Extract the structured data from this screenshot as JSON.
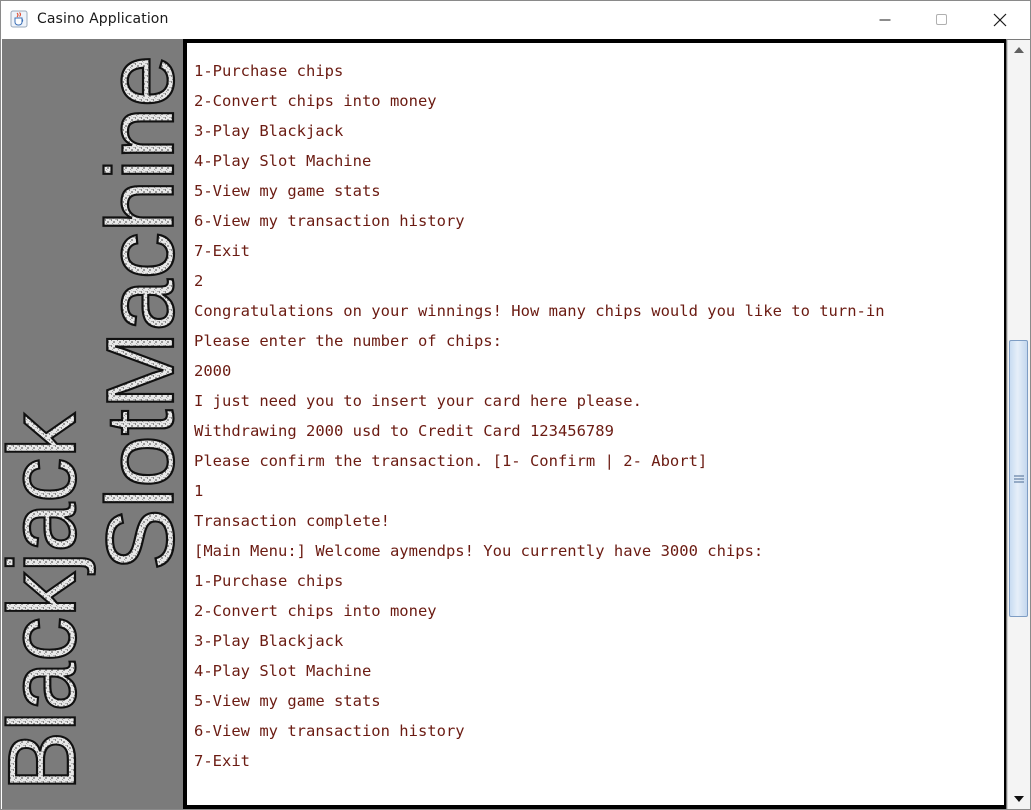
{
  "window": {
    "title": "Casino Application",
    "controls": [
      "minimize",
      "maximize",
      "close"
    ]
  },
  "side_art": {
    "words": [
      "Blackjack",
      "SlotMachine"
    ]
  },
  "console": {
    "lines": [
      "1-Purchase chips",
      "2-Convert chips into money",
      "3-Play Blackjack",
      "4-Play Slot Machine",
      "5-View my game stats",
      "6-View my transaction history",
      "7-Exit",
      "2",
      "Congratulations on your winnings! How many chips would you like to turn-in",
      "Please enter the number of chips:",
      "2000",
      "I just need you to insert your card here please.",
      "Withdrawing 2000 usd to Credit Card 123456789",
      "Please confirm the transaction. [1- Confirm | 2- Abort]",
      "1",
      "Transaction complete!",
      "[Main Menu:] Welcome aymendps! You currently have 3000 chips:",
      "1-Purchase chips",
      "2-Convert chips into money",
      "3-Play Blackjack",
      "4-Play Slot Machine",
      "5-View my game stats",
      "6-View my transaction history",
      "7-Exit"
    ]
  },
  "scrollbar": {
    "position_fraction": 0.62,
    "visible_fraction": 0.38
  },
  "colors": {
    "console_text": "#6b1b12",
    "console_bg": "#ffffff",
    "side_bg": "#7b7b7b",
    "scroll_thumb": "#c9dcf2"
  },
  "icons": {
    "app": "java-cup-icon",
    "minimize": "minimize-icon",
    "maximize": "maximize-icon",
    "close": "close-icon",
    "scroll_up": "chevron-up-icon",
    "scroll_down": "chevron-down-icon"
  }
}
